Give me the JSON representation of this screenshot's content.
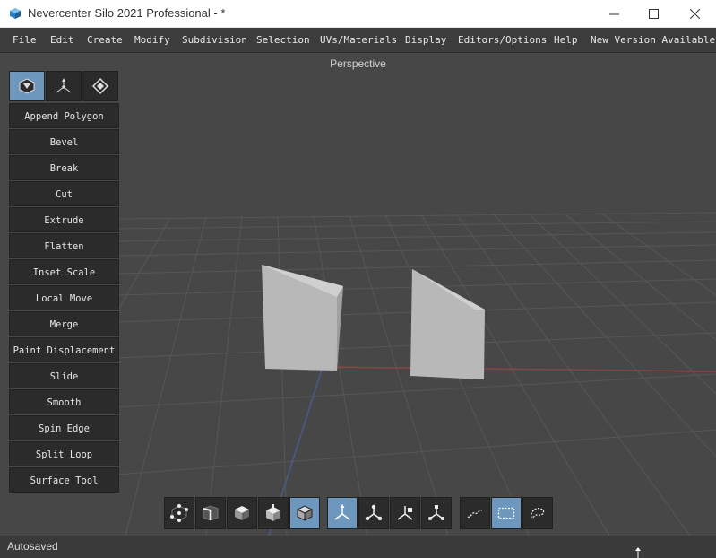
{
  "window": {
    "title": "Nevercenter Silo 2021 Professional - *",
    "minimize": "—",
    "maximize": "☐",
    "close": "✕"
  },
  "menu": [
    "File",
    "Edit",
    "Create",
    "Modify",
    "Subdivision",
    "Selection",
    "UVs/Materials",
    "Display",
    "Editors/Options",
    "Help",
    "New Version Available"
  ],
  "viewport": {
    "label": "Perspective"
  },
  "mode_tabs": [
    {
      "icon": "modeling-mode-icon",
      "active": true
    },
    {
      "icon": "transform-mode-icon",
      "active": false
    },
    {
      "icon": "uv-mode-icon",
      "active": false
    }
  ],
  "tools": [
    "Append Polygon",
    "Bevel",
    "Break",
    "Cut",
    "Extrude",
    "Flatten",
    "Inset Scale",
    "Local Move",
    "Merge",
    "Paint Displacement",
    "Slide",
    "Smooth",
    "Spin Edge",
    "Split Loop",
    "Surface Tool"
  ],
  "selection_modes": [
    {
      "icon": "vertex-select-icon",
      "active": false
    },
    {
      "icon": "edge-select-icon",
      "active": false
    },
    {
      "icon": "face-select-icon",
      "active": false
    },
    {
      "icon": "object-vertex-select-icon",
      "active": false
    },
    {
      "icon": "object-select-icon",
      "active": true
    }
  ],
  "manipulators": [
    {
      "icon": "move-manipulator-icon",
      "active": true
    },
    {
      "icon": "universal-manipulator-icon",
      "active": false
    },
    {
      "icon": "rotate-manipulator-icon",
      "active": false
    },
    {
      "icon": "scale-manipulator-icon",
      "active": false
    }
  ],
  "select_tools": [
    {
      "icon": "lasso-select-icon",
      "active": false
    },
    {
      "icon": "rect-select-icon",
      "active": true
    },
    {
      "icon": "paint-select-icon",
      "active": false
    }
  ],
  "status": {
    "text": "Autosaved"
  },
  "colors": {
    "viewport_bg": "#474747",
    "active_blue": "#6e97bd",
    "object_gray": "#bcbcbc",
    "grid_line": "#555555",
    "x_axis": "#8a4545",
    "z_axis": "#4a5a8a"
  }
}
